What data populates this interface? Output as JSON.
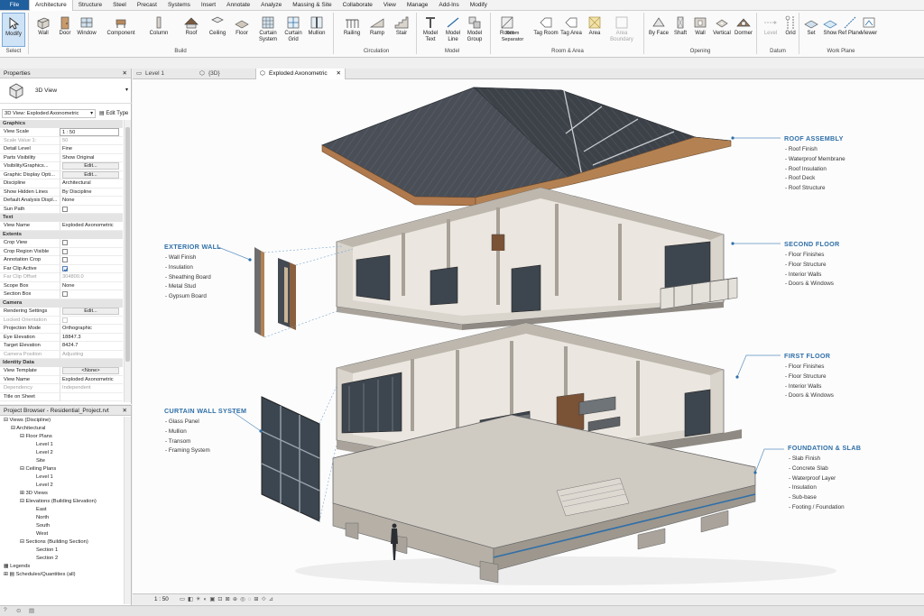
{
  "menu": {
    "file": "File",
    "tabs": [
      "Architecture",
      "Structure",
      "Steel",
      "Precast",
      "Systems",
      "Insert",
      "Annotate",
      "Analyze",
      "Massing & Site",
      "Collaborate",
      "View",
      "Manage",
      "Add-Ins",
      "Modify"
    ],
    "active_tab": "Architecture"
  },
  "ribbon": {
    "select": {
      "tool": "Modify",
      "label": "Select"
    },
    "build": {
      "tools": [
        "Wall",
        "Door",
        "Window",
        "Component",
        "Column",
        "Roof",
        "Ceiling",
        "Floor",
        "Curtain System",
        "Curtain Grid",
        "Mullion"
      ],
      "label": "Build"
    },
    "circulation": {
      "tools": [
        "Railing",
        "Ramp",
        "Stair"
      ],
      "label": "Circulation"
    },
    "model": {
      "tools": [
        "Model Text",
        "Model Line",
        "Model Group"
      ],
      "label": "Model"
    },
    "room_area": {
      "tools": [
        "Room",
        "Room Separator",
        "Tag Room",
        "Area",
        "Area Boundary",
        "Tag Area"
      ],
      "label": "Room & Area"
    },
    "opening": {
      "tools": [
        "By Face",
        "Shaft",
        "Wall",
        "Vertical",
        "Dormer"
      ],
      "label": "Opening"
    },
    "datum": {
      "tools": [
        "Level",
        "Grid"
      ],
      "label": "Datum"
    },
    "work_plane": {
      "tools": [
        "Set",
        "Show",
        "Ref Plane",
        "Viewer"
      ],
      "label": "Work Plane"
    }
  },
  "properties": {
    "title": "Properties",
    "type_name": "3D View",
    "view_selector": "3D View: Exploded Axonometric",
    "edit_type": "Edit Type",
    "graphics_header": "Graphics",
    "text_header": "Text",
    "extents_header": "Extents",
    "camera_header": "Camera",
    "identity_header": "Identity Data",
    "rows": {
      "view_scale": [
        "View Scale",
        "1 : 50"
      ],
      "scale_value": [
        "Scale Value  1:",
        "50"
      ],
      "detail_level": [
        "Detail Level",
        "Fine"
      ],
      "parts_visibility": [
        "Parts Visibility",
        "Show Original"
      ],
      "visibility_graphics": [
        "Visibility/Graphics...",
        "Edit..."
      ],
      "graphic_display": [
        "Graphic Display Opti...",
        "Edit..."
      ],
      "discipline": [
        "Discipline",
        "Architectural"
      ],
      "show_hidden": [
        "Show Hidden Lines",
        "By Discipline"
      ],
      "default_analysis": [
        "Default Analysis Displ...",
        "None"
      ],
      "sun_path": [
        "Sun Path",
        ""
      ],
      "view_name_text": [
        "View Name",
        "Exploded Axonometric"
      ],
      "crop_view": [
        "Crop View",
        ""
      ],
      "crop_region": [
        "Crop Region Visible",
        ""
      ],
      "annotation_crop": [
        "Annotation Crop",
        ""
      ],
      "far_clip_active": [
        "Far Clip Active",
        ""
      ],
      "far_clip_offset": [
        "Far Clip Offset",
        "304800.0"
      ],
      "scope_box": [
        "Scope Box",
        "None"
      ],
      "section_box": [
        "Section Box",
        ""
      ],
      "rendering": [
        "Rendering Settings",
        "Edit..."
      ],
      "locked": [
        "Locked Orientation",
        ""
      ],
      "projection": [
        "Projection Mode",
        "Orthographic"
      ],
      "eye_elev": [
        "Eye Elevation",
        "18847.3"
      ],
      "target_elev": [
        "Target Elevation",
        "8424.7"
      ],
      "camera_pos": [
        "Camera Position",
        "Adjusting"
      ],
      "view_template": [
        "View Template",
        "<None>"
      ],
      "view_name": [
        "View Name",
        "Exploded Axonometric"
      ],
      "dependency": [
        "Dependency",
        "Independent"
      ],
      "title_sheet": [
        "Title on Sheet",
        ""
      ]
    }
  },
  "browser": {
    "title": "Project Browser - Residential_Project.rvt",
    "views": "Views (Discipline)",
    "architectural": "Architectural",
    "floor_plans": "Floor Plans",
    "fp_items": [
      "Level 1",
      "Level 2",
      "Site"
    ],
    "ceiling_plans": "Ceiling Plans",
    "cp_items": [
      "Level 1",
      "Level 2"
    ],
    "views_3d": "3D Views",
    "elevations": "Elevations (Building Elevation)",
    "elev_items": [
      "East",
      "North",
      "South",
      "West"
    ],
    "sections": "Sections (Building Section)",
    "sec_items": [
      "Section 1",
      "Section 2"
    ],
    "legends": "Legends",
    "schedules": "Schedules/Quantities (all)"
  },
  "view_tabs": [
    "Level 1",
    "{3D}",
    "Exploded Axonometric"
  ],
  "callouts": {
    "roof": {
      "title": "ROOF ASSEMBLY",
      "items": [
        "Roof Finish",
        "Waterproof Membrane",
        "Roof Insulation",
        "Roof Deck",
        "Roof Structure"
      ]
    },
    "second": {
      "title": "SECOND FLOOR",
      "items": [
        "Floor Finishes",
        "Floor Structure",
        "Interior Walls",
        "Doors & Windows"
      ]
    },
    "first": {
      "title": "FIRST FLOOR",
      "items": [
        "Floor Finishes",
        "Floor Structure",
        "Interior Walls",
        "Doors & Windows"
      ]
    },
    "foundation": {
      "title": "FOUNDATION & SLAB",
      "items": [
        "Slab Finish",
        "Concrete Slab",
        "Waterproof Layer",
        "Insulation",
        "Sub-base",
        "Footing / Foundation"
      ]
    },
    "exterior": {
      "title": "EXTERIOR WALL",
      "items": [
        "Wall Finish",
        "Insulation",
        "Sheathing Board",
        "Metal Stud",
        "Gypsum Board"
      ]
    },
    "curtain": {
      "title": "CURTAIN WALL SYSTEM",
      "items": [
        "Glass Panel",
        "Mullion",
        "Transom",
        "Framing System"
      ]
    }
  },
  "view_control": {
    "scale": "1 : 50"
  },
  "colors": {
    "accent": "#2f6fa8",
    "file_tab": "#1f5f9e",
    "roof": "#4a4f57",
    "concrete": "#cfcac2",
    "wood": "#b07a4e",
    "glass": "#3c4650"
  }
}
